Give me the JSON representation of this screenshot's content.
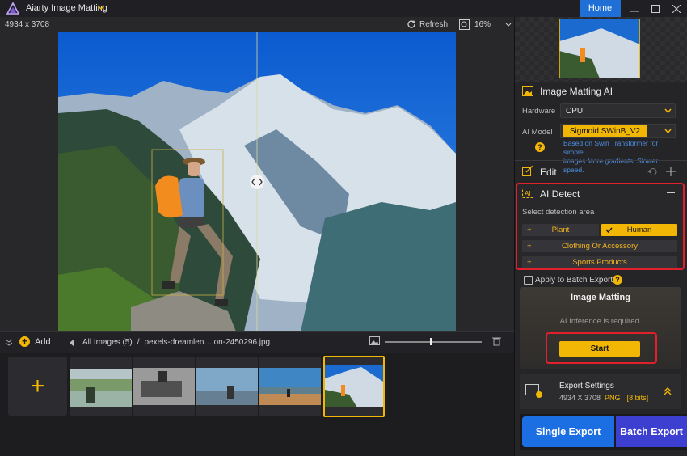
{
  "app": {
    "title": "Aiarty Image Matting",
    "home_label": "Home"
  },
  "canvas": {
    "dimensions": "4934 x 3708",
    "refresh_label": "Refresh",
    "zoom": "16%"
  },
  "strip": {
    "add_label": "Add",
    "breadcrumb_root": "All Images (5)",
    "breadcrumb_sep": "/",
    "breadcrumb_file": "pexels-dreamlen…ion-2450296.jpg"
  },
  "panel": {
    "section_title": "Image Matting AI",
    "hardware_label": "Hardware",
    "hardware_value": "CPU",
    "model_label": "AI Model",
    "model_value": "Sigmoid SWinB_V2",
    "model_desc_1": "Based on Swin Transformer for simple",
    "model_desc_2": "images More gradients. Slower speed.",
    "edit_label": "Edit",
    "ai_detect_label": "AI Detect",
    "detect_hint": "Select detection area",
    "cat_plant": "Plant",
    "cat_human": "Human",
    "cat_clothing": "Clothing Or Accessory",
    "cat_sports": "Sports Products",
    "batch_apply": "Apply to Batch Export",
    "matting_title": "Image Matting",
    "matting_msg": "AI Inference is required.",
    "start_label": "Start",
    "export_title": "Export Settings",
    "export_size": "4934 X 3708",
    "export_format": "PNG",
    "export_bits": "[8 bits]",
    "single_export": "Single Export",
    "batch_export": "Batch Export"
  },
  "colors": {
    "accent": "#f2b705",
    "home": "#1f6fd6",
    "highlight": "#e0202a",
    "export_blue": "#1c6fe3"
  },
  "icons": [
    "logo-icon",
    "chevron-down-icon",
    "minimize-icon",
    "maximize-icon",
    "close-icon",
    "refresh-icon",
    "zoom-icon",
    "plus-icon",
    "back-arrow-icon",
    "image-icon",
    "trash-icon",
    "undo-icon",
    "collapse-icon",
    "question-icon",
    "check-icon",
    "export-settings-icon",
    "chevron-up-icon"
  ]
}
